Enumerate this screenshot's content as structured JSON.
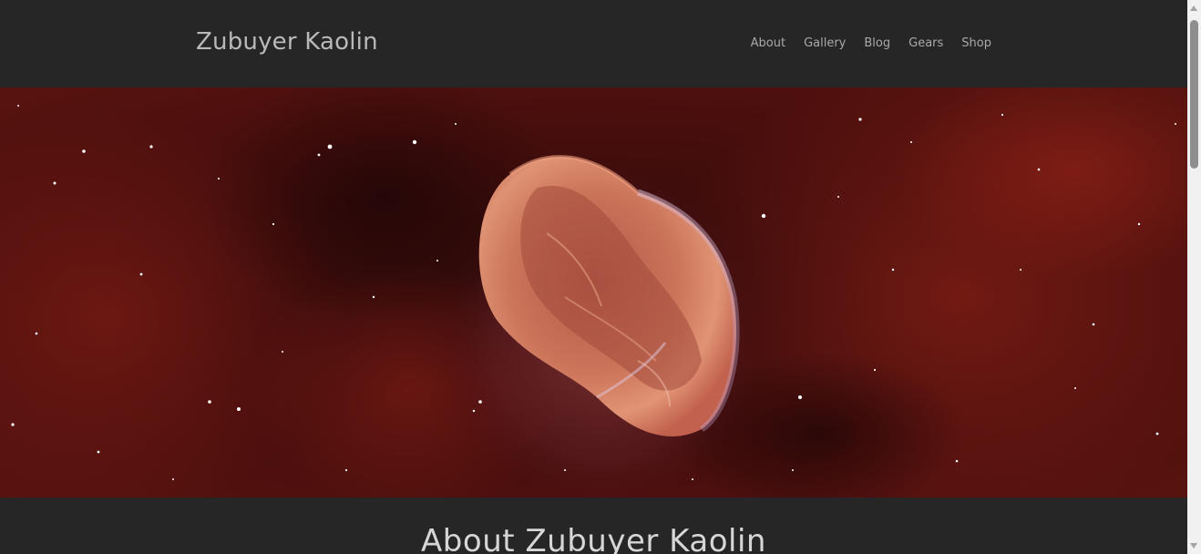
{
  "site": {
    "title": "Zubuyer Kaolin"
  },
  "nav": {
    "items": [
      "About",
      "Gallery",
      "Blog",
      "Gears",
      "Shop"
    ]
  },
  "hero": {
    "image": "crescent-nebula-image"
  },
  "about": {
    "title": "About Zubuyer Kaolin"
  },
  "colors": {
    "background": "#262626",
    "header_text": "#b9b9b9",
    "nav_text": "#a9a9a9",
    "nebula_red": "#6e1812"
  }
}
